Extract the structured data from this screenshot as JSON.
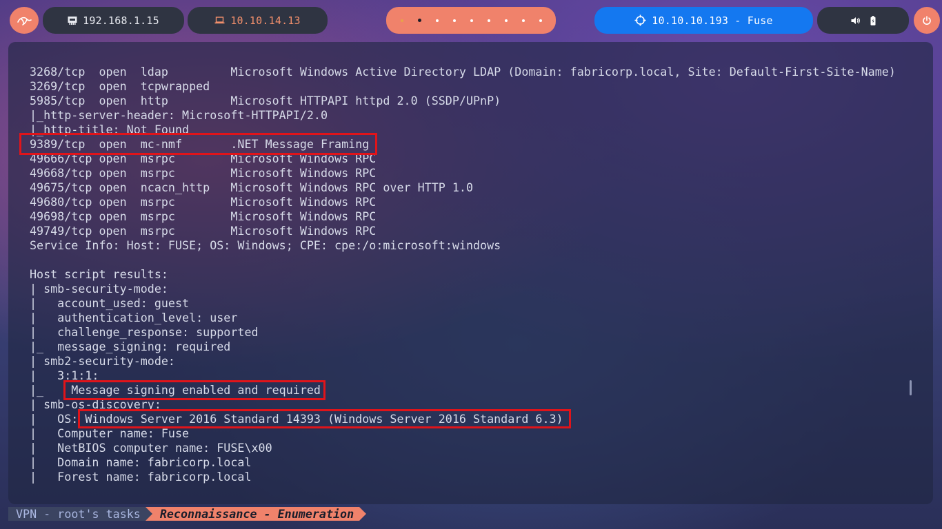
{
  "topbar": {
    "logo_icon": "kali-dragon-icon",
    "local_ip": "192.168.1.15",
    "vpn_ip": "10.10.14.13",
    "workspace_count": 9,
    "active_workspace": 2,
    "target_text": "10.10.10.193 - Fuse",
    "tray_icons": [
      "volume-icon",
      "battery-icon"
    ],
    "power_icon": "power-icon",
    "colors": {
      "accent": "#f0826b",
      "target": "#1478f0",
      "pill_bg": "#2f3442",
      "vpn_ip": "#f3906c"
    }
  },
  "terminal": {
    "lines": [
      "3268/tcp  open  ldap         Microsoft Windows Active Directory LDAP (Domain: fabricorp.local, Site: Default-First-Site-Name)",
      "3269/tcp  open  tcpwrapped",
      "5985/tcp  open  http         Microsoft HTTPAPI httpd 2.0 (SSDP/UPnP)",
      "|_http-server-header: Microsoft-HTTPAPI/2.0",
      "|_http-title: Not Found",
      "9389/tcp  open  mc-nmf       .NET Message Framing",
      "49666/tcp open  msrpc        Microsoft Windows RPC",
      "49668/tcp open  msrpc        Microsoft Windows RPC",
      "49675/tcp open  ncacn_http   Microsoft Windows RPC over HTTP 1.0",
      "49680/tcp open  msrpc        Microsoft Windows RPC",
      "49698/tcp open  msrpc        Microsoft Windows RPC",
      "49749/tcp open  msrpc        Microsoft Windows RPC",
      "Service Info: Host: FUSE; OS: Windows; CPE: cpe:/o:microsoft:windows",
      "",
      "Host script results:",
      "| smb-security-mode:",
      "|   account_used: guest",
      "|   authentication_level: user",
      "|   challenge_response: supported",
      "|_  message_signing: required",
      "| smb2-security-mode:",
      "|   3:1:1:",
      "|_    Message signing enabled and required",
      "| smb-os-discovery:",
      "|   OS: Windows Server 2016 Standard 14393 (Windows Server 2016 Standard 6.3)",
      "|   Computer name: Fuse",
      "|   NetBIOS computer name: FUSE\\x00",
      "|   Domain name: fabricorp.local",
      "|   Forest name: fabricorp.local"
    ],
    "highlight_color": "#e0141a"
  },
  "statusbar": {
    "session": "VPN - root's tasks",
    "window": "Reconnaissance - Enumeration"
  }
}
